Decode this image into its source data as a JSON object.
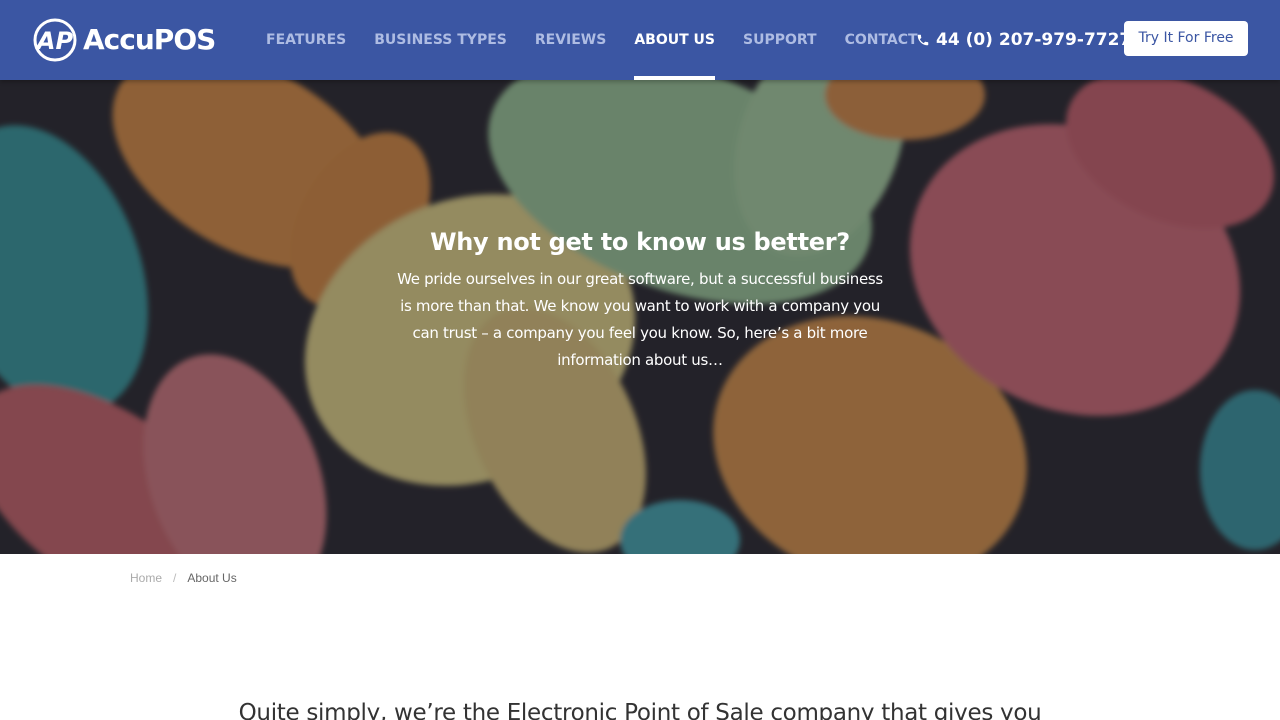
{
  "brand": {
    "name": "AccuPOS",
    "mark": "AP"
  },
  "nav": [
    {
      "label": "FEATURES",
      "active": false
    },
    {
      "label": "BUSINESS TYPES",
      "active": false
    },
    {
      "label": "REVIEWS",
      "active": false
    },
    {
      "label": "ABOUT US",
      "active": true
    },
    {
      "label": "SUPPORT",
      "active": false
    },
    {
      "label": "CONTACT",
      "active": false
    }
  ],
  "header": {
    "phone": "44 (0) 207-979-7727",
    "phone_icon": "phone-icon",
    "cta_label": "Try It For Free"
  },
  "hero": {
    "title": "Why not get to know us better?",
    "text": "We pride ourselves in our great software, but a successful business is more than that. We know you want to work with a company you can trust – a company you feel you know. So, here’s a bit more information about us…"
  },
  "breadcrumb": {
    "home": "Home",
    "separator": "/",
    "current": "About Us"
  },
  "intro": {
    "text": "Quite simply, we’re the Electronic Point of Sale company that gives you"
  },
  "colors": {
    "header_bg": "#3b56a3",
    "nav_inactive": "#aebce3",
    "nav_active": "#ffffff",
    "cta_bg": "#ffffff",
    "cta_text": "#3b56a3"
  }
}
